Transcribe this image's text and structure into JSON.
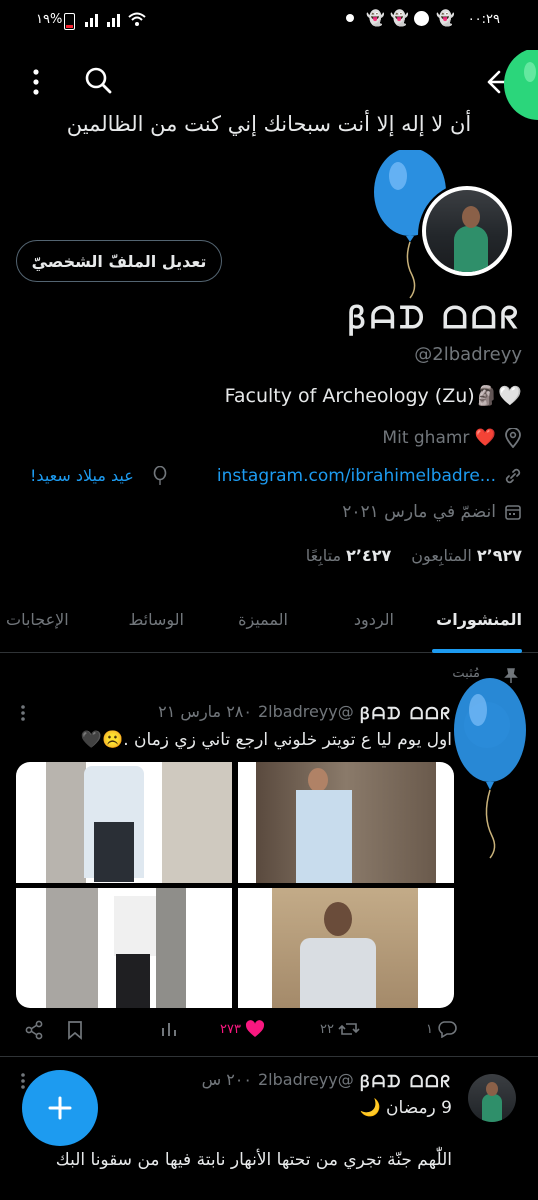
{
  "status_bar": {
    "time": "٠٠:٢٩",
    "battery": "١٩%"
  },
  "header": {
    "banner_text": "أن لا إله إلا أنت سبحانك إني كنت من الظالمين",
    "back_icon": "back-arrow-icon",
    "search_icon": "search-icon",
    "more_icon": "more-vertical-icon"
  },
  "profile": {
    "edit_button": "تعديل الملفّ الشخصيّ",
    "display_name": "ꞵᗩᗪ ᗝᗝᖇ",
    "handle": "@2lbadreyy",
    "bio": "Faculty of Archeology (Zu)🗿🤍",
    "location": "Mit ghamr ❤️",
    "website": "instagram.com/ibrahimelbadre...",
    "birthday": "عيد ميلاد سعيد!",
    "joined": "انضمّ في مارس ٢٠٢١",
    "followers_count": "٢٬٩٢٧",
    "followers_label": "المتابِعون",
    "following_count": "٢٬٤٢٧",
    "following_label": "متابِعًا"
  },
  "tabs": [
    {
      "label": "المنشورات",
      "active": true
    },
    {
      "label": "الردود",
      "active": false
    },
    {
      "label": "المميزة",
      "active": false
    },
    {
      "label": "الوسائط",
      "active": false
    },
    {
      "label": "الإعجابات",
      "active": false
    }
  ],
  "posts": [
    {
      "pinned_label": "مُثبت",
      "name": "ꞵᗩᗪ ᗝᗝᖇ",
      "handle": "@2lbadreyy",
      "time": "٢٨٠ مارس ٢١",
      "text": "اول يوم ليا ع تويتر خلوني ارجع تاني زي زمان .☹️🖤",
      "replies": "١",
      "reposts": "٢٢",
      "likes": "٢٧٣"
    },
    {
      "name": "ꞵᗩᗪ ᗝᗝᖇ",
      "handle": "@2lbadreyy",
      "time": "٢٠٠ س",
      "text": "9 رمضان 🌙",
      "text2": "اللّٰهم جنّة تجري من تحتها الأنهار نابتة فيها من سقونا البك"
    }
  ],
  "colors": {
    "accent": "#1d9bf0",
    "like": "#f91880",
    "muted": "#71767b"
  }
}
